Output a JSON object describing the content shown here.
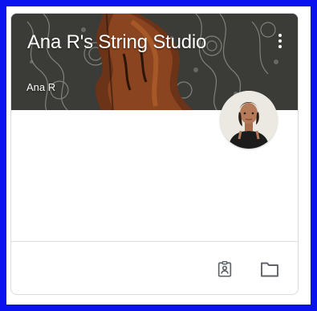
{
  "class_card": {
    "title": "Ana R's String Studio",
    "owner": "Ana R",
    "menu_icon": "more-vert-icon",
    "avatar_icon": "teacher-avatar"
  },
  "footer": {
    "actions": [
      {
        "icon": "assignment-ind-icon"
      },
      {
        "icon": "folder-icon"
      }
    ]
  },
  "colors": {
    "page_border": "#0a12f0",
    "banner_bg": "#3a3a36",
    "card_border": "#dadce0"
  }
}
